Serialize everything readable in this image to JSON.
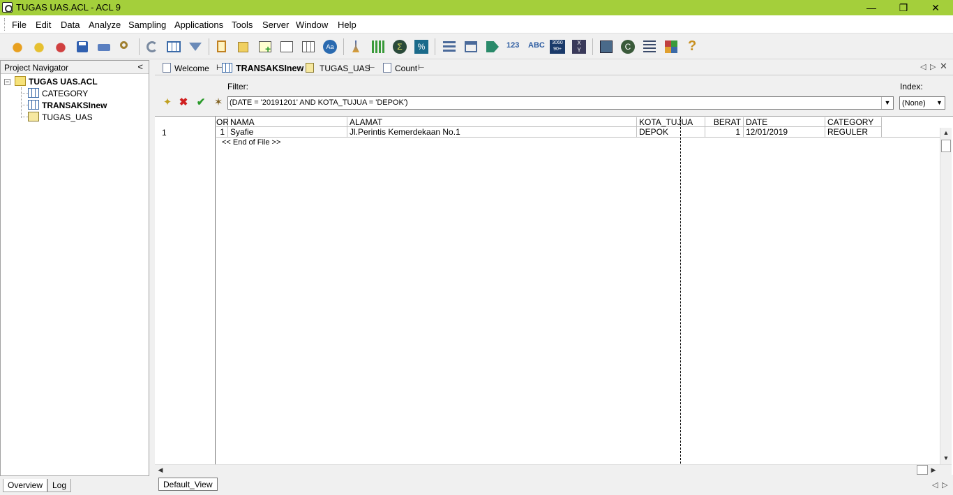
{
  "window": {
    "title": "TUGAS UAS.ACL - ACL 9"
  },
  "menu": [
    "File",
    "Edit",
    "Data",
    "Analyze",
    "Sampling",
    "Applications",
    "Tools",
    "Server",
    "Window",
    "Help"
  ],
  "navigator": {
    "title": "Project Navigator",
    "collapse": "<",
    "project": "TUGAS UAS.ACL",
    "items": [
      {
        "label": "CATEGORY",
        "icon": "table-icon"
      },
      {
        "label": "TRANSAKSInew",
        "icon": "table-icon"
      },
      {
        "label": "TUGAS_UAS",
        "icon": "script-icon"
      }
    ],
    "tabs": [
      "Overview",
      "Log"
    ]
  },
  "doc_tabs": [
    {
      "label": "Welcome"
    },
    {
      "label": "TRANSAKSInew"
    },
    {
      "label": "TUGAS_UAS"
    },
    {
      "label": "Count"
    }
  ],
  "filter": {
    "label": "Filter:",
    "value": "(DATE  = '20191201' AND KOTA_TUJUA = 'DEPOK')"
  },
  "index": {
    "label": "Index:",
    "value": "(None)"
  },
  "table": {
    "columns": [
      "OR",
      "NAMA",
      "ALAMAT",
      "KOTA_TUJUA",
      "BERAT",
      "DATE",
      "CATEGORY"
    ],
    "rows": [
      {
        "num": "1",
        "or": "1",
        "nama": "Syafie",
        "alamat": "Jl.Perintis Kemerdekaan No.1",
        "kota": "DEPOK",
        "berat": "1",
        "date": "12/01/2019",
        "category": "REGULER"
      }
    ],
    "eof": "<< End of File >>"
  },
  "view_tab": "Default_View",
  "colors": {
    "titlebar": "#a4cf3b"
  }
}
